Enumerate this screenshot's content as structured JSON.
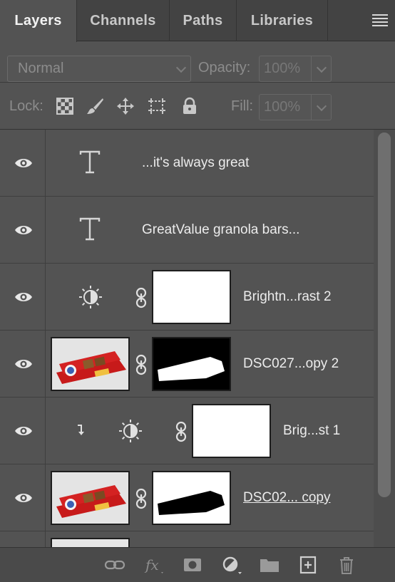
{
  "tabs": [
    {
      "label": "Layers",
      "active": true
    },
    {
      "label": "Channels",
      "active": false
    },
    {
      "label": "Paths",
      "active": false
    },
    {
      "label": "Libraries",
      "active": false
    }
  ],
  "blend": {
    "mode": "Normal",
    "opacity_label": "Opacity:",
    "opacity_value": "100%"
  },
  "lock": {
    "label": "Lock:",
    "fill_label": "Fill:",
    "fill_value": "100%"
  },
  "layers": [
    {
      "kind": "text",
      "name": "...it's always great",
      "visible": true
    },
    {
      "kind": "text",
      "name": "GreatValue granola bars...",
      "visible": true
    },
    {
      "kind": "adjustment",
      "name": "Brightn...rast 2",
      "visible": true,
      "mask": "white"
    },
    {
      "kind": "photo",
      "name": "DSC027...opy 2",
      "visible": true,
      "mask": "black-with-white-shape"
    },
    {
      "kind": "adjustment-clipped",
      "name": "Brig...st 1",
      "visible": true,
      "mask": "white"
    },
    {
      "kind": "photo",
      "name": "DSC02... copy",
      "visible": true,
      "mask": "white-with-black-shape",
      "underlined": true
    }
  ],
  "icons": {
    "panel_menu": "hamburger-menu-icon",
    "bottom": [
      "link-layers-icon",
      "fx-icon",
      "add-mask-icon",
      "new-adjustment-icon",
      "new-group-icon",
      "new-layer-icon",
      "trash-icon"
    ]
  },
  "colors": {
    "panel_bg": "#535353",
    "tab_bg": "#434343",
    "text": "#ececec"
  }
}
